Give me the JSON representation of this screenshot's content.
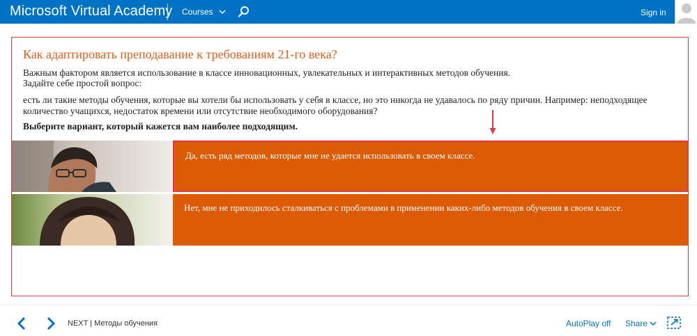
{
  "header": {
    "brand": "Microsoft Virtual Academy",
    "courses_label": "Courses",
    "signin_label": "Sign in",
    "icons": [
      "chevron-down-icon",
      "search-icon",
      "avatar"
    ]
  },
  "lesson": {
    "title": "Как адаптировать преподавание к требованиям 21-го века?",
    "line1": "Важным фактором является использование в классе инновационных, увлекательных и интерактивных методов обучения.",
    "line2": "Задайте себе простой вопрос:",
    "line3": "есть ли такие методы обучения, которые вы хотели бы использовать у себя в классе, но это никогда не удавалось по ряду причин. Например: неподходящее количество учащихся, недостаток времени или отсутствие необходимого оборудования?",
    "prompt": "Выберите вариант, который кажется вам наиболее подходящим.",
    "options": [
      {
        "text": "Да, есть ряд методов, которые мне не удается использовать в своем классе."
      },
      {
        "text": "Нет, мне не приходилось сталкиваться с проблемами в применении каких-либо методов обучения в своем классе."
      }
    ]
  },
  "footer": {
    "next_prefix": "NEXT",
    "next_separator": " | ",
    "next_title": "Методы обучения",
    "autoplay_label": "AutoPlay off",
    "share_label": "Share"
  },
  "colors": {
    "brand_blue": "#0072c6",
    "accent_orange": "#dc5b07",
    "title_orange": "#e35d16",
    "frame_red": "#e0393e"
  }
}
